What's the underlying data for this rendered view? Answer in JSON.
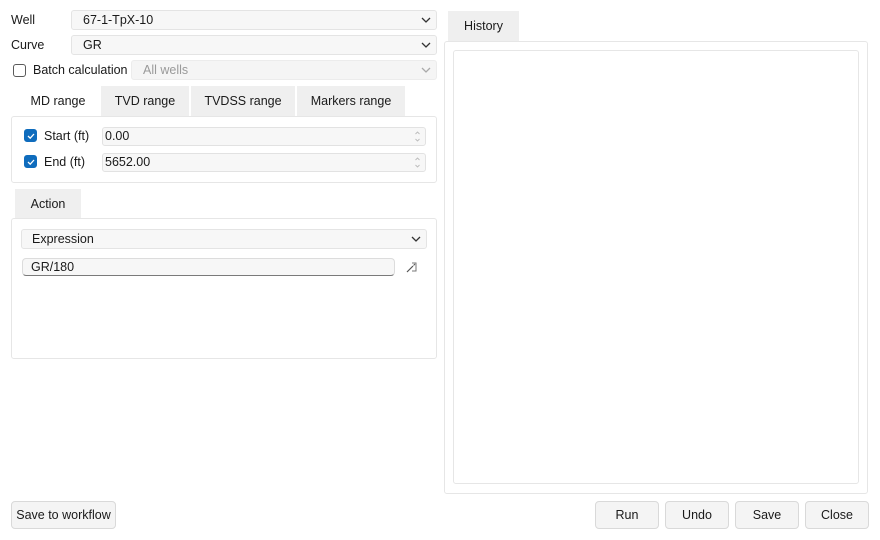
{
  "form": {
    "well_label": "Well",
    "well_value": "67-1-TpX-10",
    "curve_label": "Curve",
    "curve_value": "GR",
    "batch_label": "Batch calculation",
    "batch_checked": false,
    "batch_value": "All wells"
  },
  "range_tabs": [
    {
      "label": "MD range",
      "active": true
    },
    {
      "label": "TVD range",
      "active": false
    },
    {
      "label": "TVDSS range",
      "active": false
    },
    {
      "label": "Markers range",
      "active": false
    }
  ],
  "range": {
    "start_label": "Start (ft)",
    "start_checked": true,
    "start_value": "0.00",
    "end_label": "End (ft)",
    "end_checked": true,
    "end_value": "5652.00"
  },
  "action": {
    "tab_label": "Action",
    "type_value": "Expression",
    "expression_value": "GR/180"
  },
  "history": {
    "tab_label": "History"
  },
  "buttons": {
    "save_to_workflow": "Save to workflow",
    "run": "Run",
    "undo": "Undo",
    "save": "Save",
    "close": "Close"
  },
  "colors": {
    "accent": "#0f6cbd",
    "tab_inactive": "#efefef",
    "border": "#e6e6e6"
  }
}
